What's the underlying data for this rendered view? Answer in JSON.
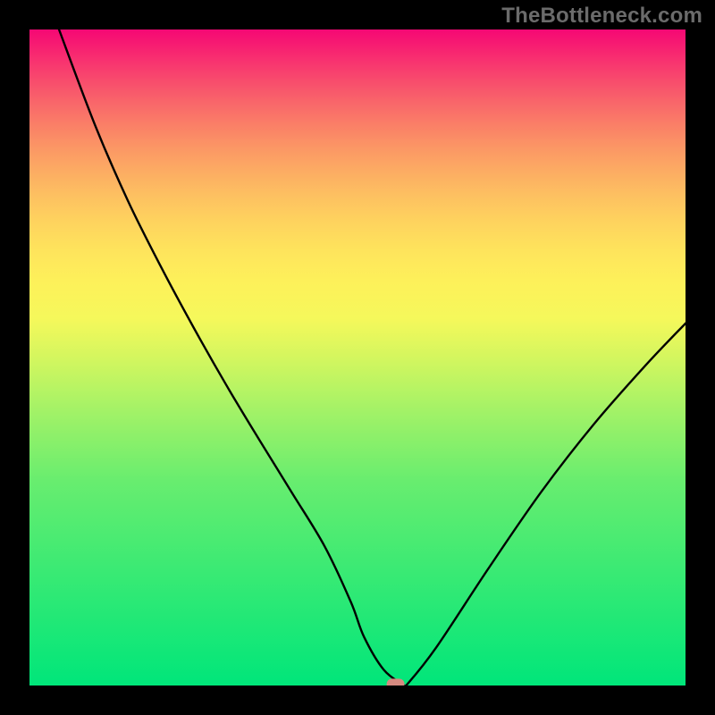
{
  "watermark_text": "TheBottleneck.com",
  "chart_data": {
    "type": "line",
    "title": "",
    "xlabel": "",
    "ylabel": "",
    "xlim": [
      0,
      100
    ],
    "ylim": [
      0,
      100
    ],
    "background_band_colors": [
      "#00e67a",
      "#68ed6f",
      "#a2f267",
      "#d1f65f",
      "#f5f85b",
      "#fdf15a",
      "#fee45c",
      "#fed35e",
      "#fdc061",
      "#fcab63",
      "#fb9665",
      "#fa7f67",
      "#f9686a",
      "#f8506c",
      "#f8386f",
      "#f71f71",
      "#f50874"
    ],
    "curve": {
      "x": [
        4.5,
        10,
        15,
        20,
        25,
        30,
        35,
        40,
        45,
        49,
        51,
        54,
        57,
        57.5,
        62,
        70,
        78,
        86,
        94,
        100
      ],
      "y": [
        100,
        85.4,
        73.9,
        63.9,
        54.6,
        45.8,
        37.5,
        29.4,
        21.2,
        12.7,
        7.4,
        2.4,
        0.1,
        0.1,
        5.8,
        17.9,
        29.5,
        39.8,
        48.9,
        55.2
      ]
    },
    "marker": {
      "x": 55.8,
      "y": 0.22
    }
  }
}
